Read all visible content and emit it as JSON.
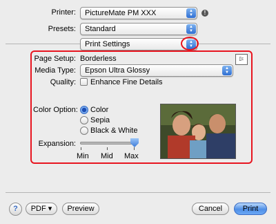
{
  "printer": {
    "label": "Printer:",
    "value": "PictureMate PM XXX"
  },
  "presets": {
    "label": "Presets:",
    "value": "Standard"
  },
  "panel": {
    "value": "Print Settings"
  },
  "page_setup": {
    "label": "Page Setup:",
    "value": "Borderless"
  },
  "media_type": {
    "label": "Media Type:",
    "value": "Epson Ultra Glossy"
  },
  "quality": {
    "label": "Quality:",
    "checkbox_label": "Enhance Fine Details",
    "checked": false
  },
  "color_option": {
    "label": "Color Option:",
    "options": [
      "Color",
      "Sepia",
      "Black & White"
    ],
    "selected": "Color"
  },
  "expansion": {
    "label": "Expansion:",
    "ticks": [
      "Min",
      "Mid",
      "Max"
    ],
    "value": "Max"
  },
  "footer": {
    "help": "?",
    "pdf": "PDF ▾",
    "preview": "Preview",
    "cancel": "Cancel",
    "print": "Print"
  },
  "colors": {
    "highlight": "#e8141f",
    "accent": "#4f8fe6"
  }
}
